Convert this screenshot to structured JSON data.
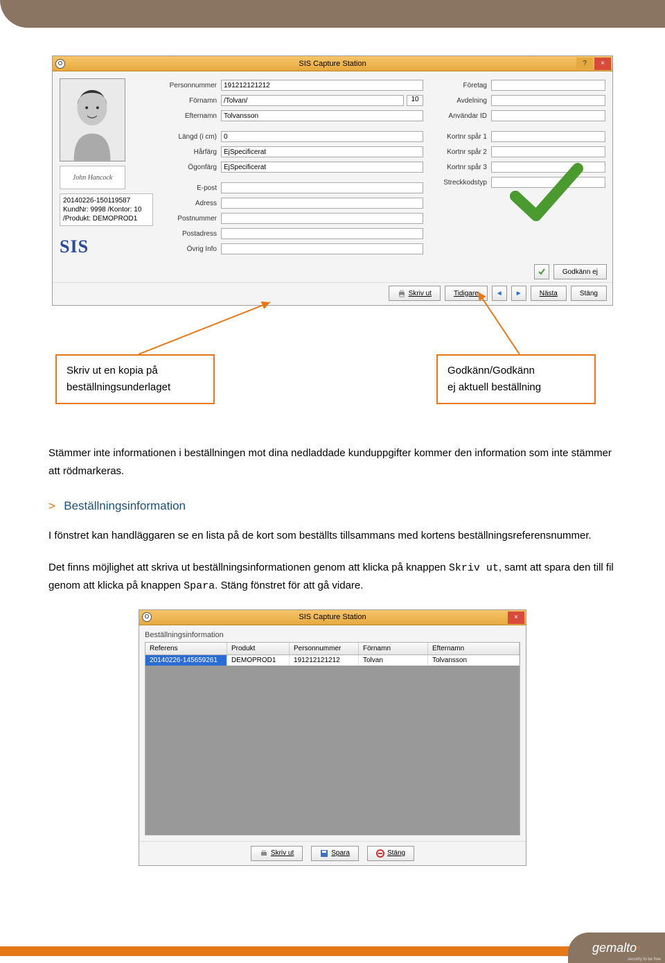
{
  "win1": {
    "title": "SIS Capture Station",
    "appicon": "O",
    "labels": {
      "personnummer": "Personnummer",
      "fornamn": "Förnamn",
      "efternamn": "Efternamn",
      "langd": "Längd (i cm)",
      "harfarg": "Hårfärg",
      "ogonfarg": "Ögonfärg",
      "epost": "E-post",
      "adress": "Adress",
      "postnummer": "Postnummer",
      "postadress": "Postadress",
      "ovriginfo": "Övrig Info",
      "foretag": "Företag",
      "avdelning": "Avdelning",
      "anvandarid": "Användar ID",
      "kortnr1": "Kortnr spår 1",
      "kortnr2": "Kortnr spår 2",
      "kortnr3": "Kortnr spår 3",
      "streckkod": "Streckkodstyp"
    },
    "values": {
      "personnummer": "191212121212",
      "fornamn": "/Tolvan/",
      "fornamn_num": "10",
      "efternamn": "Tolvansson",
      "langd": "0",
      "harfarg": "EjSpecificerat",
      "ogonfarg": "EjSpecificerat",
      "epost": "",
      "adress": "",
      "postnummer": "",
      "postadress": "",
      "ovriginfo": "",
      "foretag": "",
      "avdelning": "",
      "anvandarid": "",
      "kortnr1": "",
      "kortnr2": "",
      "kortnr3": "",
      "streckkod": ""
    },
    "signature": "John Hancock",
    "info_id": "20140226-150119587",
    "info_text": "KundNr: 9998 /Kontor: 10 /Produkt: DEMOPROD1",
    "sis": "SIS",
    "buttons": {
      "godkann_ej": "Godkänn ej",
      "skriv_ut": "Skriv ut",
      "tidigare": "Tidigare",
      "nasta": "Nästa",
      "stang": "Stäng"
    }
  },
  "callouts": {
    "left_l1": "Skriv ut en kopia på",
    "left_l2": "beställningsunderlaget",
    "right_l1": "Godkänn/Godkänn",
    "right_l2": "ej aktuell beställning"
  },
  "body": {
    "p1": "Stämmer inte informationen i beställningen mot dina nedladdade kunduppgifter kommer den information som inte stämmer att rödmarkeras.",
    "h1": "Beställningsinformation",
    "p2a": "I fönstret kan handläggaren se en lista på de kort som beställts tillsammans med kortens beställningsreferensnummer.",
    "p3a": "Det finns möjlighet att skriva ut beställningsinformationen genom att klicka på knappen ",
    "p3m1": "Skriv ut",
    "p3b": ", samt att spara den till fil genom att klicka på knappen ",
    "p3m2": "Spara",
    "p3c": ". Stäng fönstret för att gå vidare."
  },
  "win2": {
    "title": "SIS Capture Station",
    "caption": "Beställningsinformation",
    "headers": [
      "Referens",
      "Produkt",
      "Personnummer",
      "Förnamn",
      "Efternamn"
    ],
    "row": [
      "20140226-145659261",
      "DEMOPROD1",
      "191212121212",
      "Tolvan",
      "Tolvansson"
    ],
    "buttons": {
      "skriv_ut": "Skriv ut",
      "spara": "Spara",
      "stang": "Stäng"
    }
  },
  "footer": {
    "brand": "gemalto",
    "x": "×",
    "tag": "security to be free"
  }
}
